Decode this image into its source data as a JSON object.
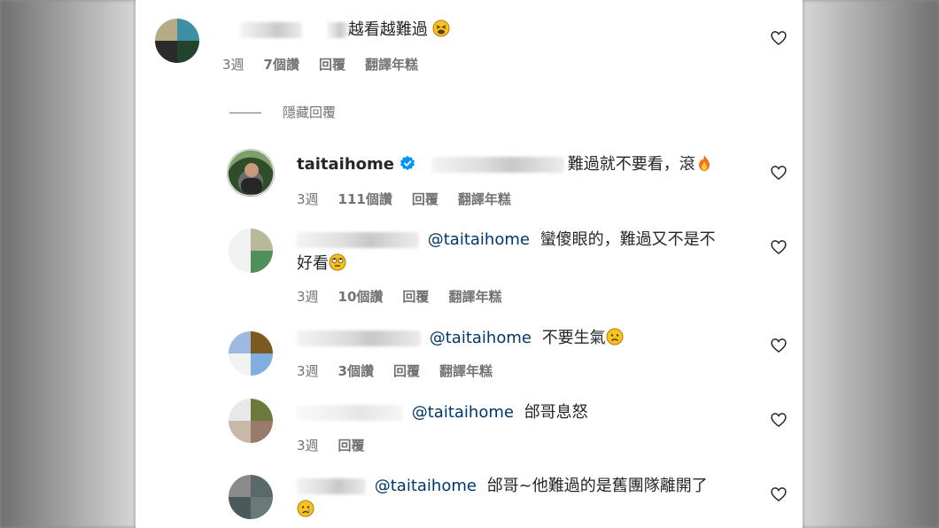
{
  "comments": [
    {
      "text": "越看越難過",
      "emoji": "tired-face-emoji",
      "meta": {
        "time": "3週",
        "likes": "7個讚",
        "reply": "回覆",
        "translate": "翻譯年糕"
      }
    },
    {
      "username": "taitaihome",
      "text": "難過就不要看，滾",
      "emoji": "fire-emoji",
      "meta": {
        "time": "3週",
        "likes": "111個讚",
        "reply": "回覆",
        "translate": "翻譯年糕"
      }
    },
    {
      "mention": "@taitaihome",
      "text_line1": "蠻傻眼的，難過又不是不",
      "text_line2": "好看",
      "emoji": "eye-roll-emoji",
      "meta": {
        "time": "3週",
        "likes": "10個讚",
        "reply": "回覆",
        "translate": "翻譯年糕"
      }
    },
    {
      "mention": "@taitaihome",
      "text": "不要生氣",
      "emoji": "sad-face-emoji",
      "meta": {
        "time": "3週",
        "likes": "3個讚",
        "reply": "回覆",
        "translate": "翻譯年糕"
      }
    },
    {
      "mention": "@taitaihome",
      "text": "邰哥息怒",
      "meta": {
        "time": "3週",
        "reply": "回覆"
      }
    },
    {
      "mention": "@taitaihome",
      "text": "邰哥~他難過的是舊團隊離開了",
      "emoji": "crying-face-emoji"
    }
  ],
  "hide_replies": "隱藏回覆",
  "colors": {
    "mention": "#00376b",
    "meta": "#737373",
    "verified": "#0095f6"
  }
}
